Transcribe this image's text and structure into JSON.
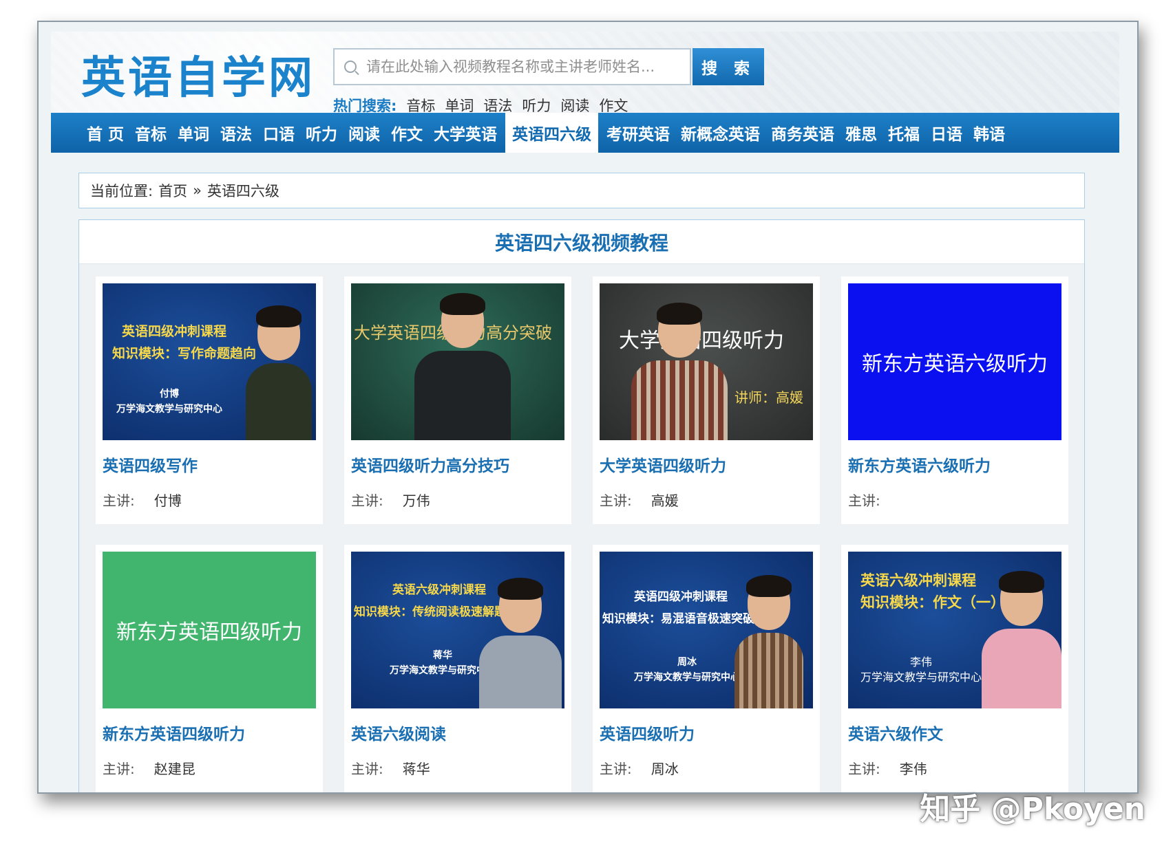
{
  "header": {
    "logo": "英语自学网",
    "search_placeholder": "请在此处输入视频教程名称或主讲老师姓名...",
    "search_button": "搜 索",
    "hot_label": "热门搜索:",
    "hot_items": [
      "音标",
      "单词",
      "语法",
      "听力",
      "阅读",
      "作文"
    ]
  },
  "nav": {
    "items": [
      "首 页",
      "音标",
      "单词",
      "语法",
      "口语",
      "听力",
      "阅读",
      "作文",
      "大学英语",
      "英语四六级",
      "考研英语",
      "新概念英语",
      "商务英语",
      "雅思",
      "托福",
      "日语",
      "韩语"
    ],
    "active_index": 9
  },
  "breadcrumb": {
    "label": "当前位置:",
    "home": "首页",
    "sep": "»",
    "current": "英语四六级"
  },
  "panel": {
    "title": "英语四六级视频教程"
  },
  "courses": [
    {
      "title": "英语四级写作",
      "teacher_label": "主讲:",
      "teacher": "付博",
      "thumb_lines": [
        "英语四级冲刺课程",
        "知识模块：写作命题趋向"
      ],
      "thumb_sub": [
        "付博",
        "万学海文教学与研究中心"
      ]
    },
    {
      "title": "英语四级听力高分技巧",
      "teacher_label": "主讲:",
      "teacher": "万伟",
      "thumb_board": "大学英语四级听力高分突破"
    },
    {
      "title": "大学英语四级听力",
      "teacher_label": "主讲:",
      "teacher": "高媛",
      "thumb_board": "大学英语四级听力",
      "thumb_board_sub": "讲师：高媛"
    },
    {
      "title": "新东方英语六级听力",
      "teacher_label": "主讲:",
      "teacher": "",
      "thumb_text": "新东方英语六级听力"
    },
    {
      "title": "新东方英语四级听力",
      "teacher_label": "主讲:",
      "teacher": "赵建昆",
      "thumb_text": "新东方英语四级听力"
    },
    {
      "title": "英语六级阅读",
      "teacher_label": "主讲:",
      "teacher": "蒋华",
      "thumb_lines": [
        "英语六级冲刺课程",
        "知识模块：传统阅读极速解题技巧"
      ],
      "thumb_sub": [
        "蒋华",
        "万学海文教学与研究中心"
      ]
    },
    {
      "title": "英语四级听力",
      "teacher_label": "主讲:",
      "teacher": "周冰",
      "thumb_lines": [
        "英语四级冲刺课程",
        "知识模块：易混语音极速突破"
      ],
      "thumb_sub": [
        "周冰",
        "万学海文教学与研究中心"
      ]
    },
    {
      "title": "英语六级作文",
      "teacher_label": "主讲:",
      "teacher": "李伟",
      "thumb_lines": [
        "英语六级冲刺课程",
        "知识模块：作文（一）"
      ],
      "thumb_sub": [
        "李伟",
        "万学海文教学与研究中心"
      ]
    }
  ],
  "watermark": "知乎 @Pkoyen",
  "colors": {
    "brand": "#1b82cc",
    "nav_bg": "#1269ae",
    "title_blue": "#1a6fb2"
  }
}
